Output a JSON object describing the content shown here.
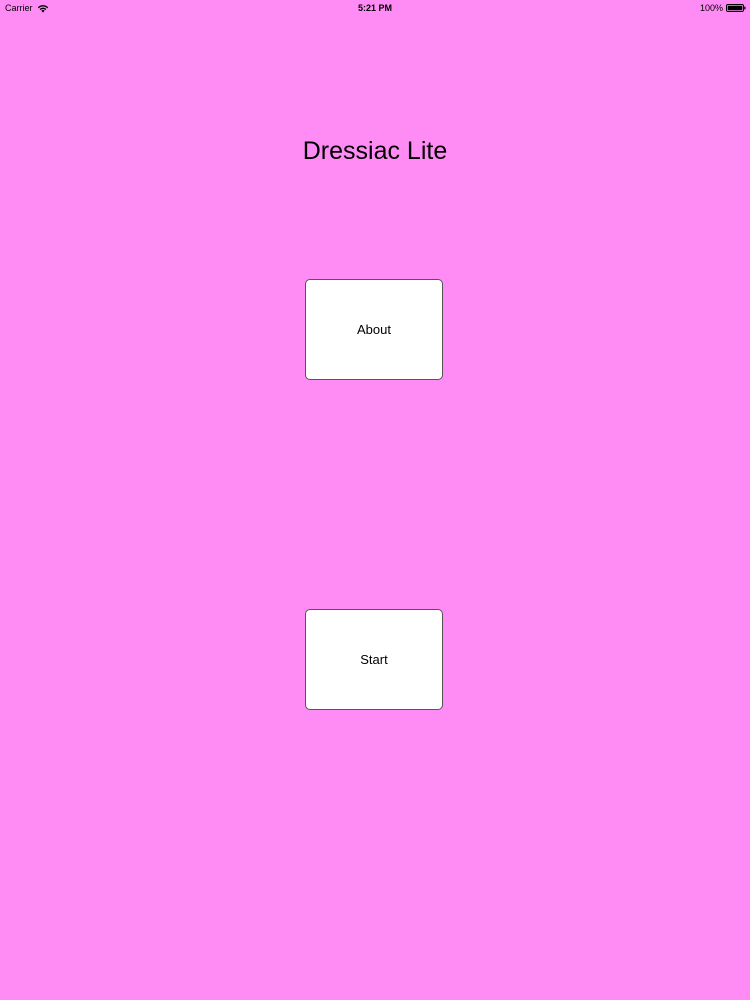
{
  "status_bar": {
    "carrier": "Carrier",
    "time": "5:21 PM",
    "battery": "100%",
    "wifi_icon": "wifi-icon",
    "battery_icon": "battery-icon"
  },
  "app": {
    "title": "Dressiac Lite",
    "background_color": "#ff8cf5"
  },
  "buttons": {
    "about_label": "About",
    "start_label": "Start"
  }
}
